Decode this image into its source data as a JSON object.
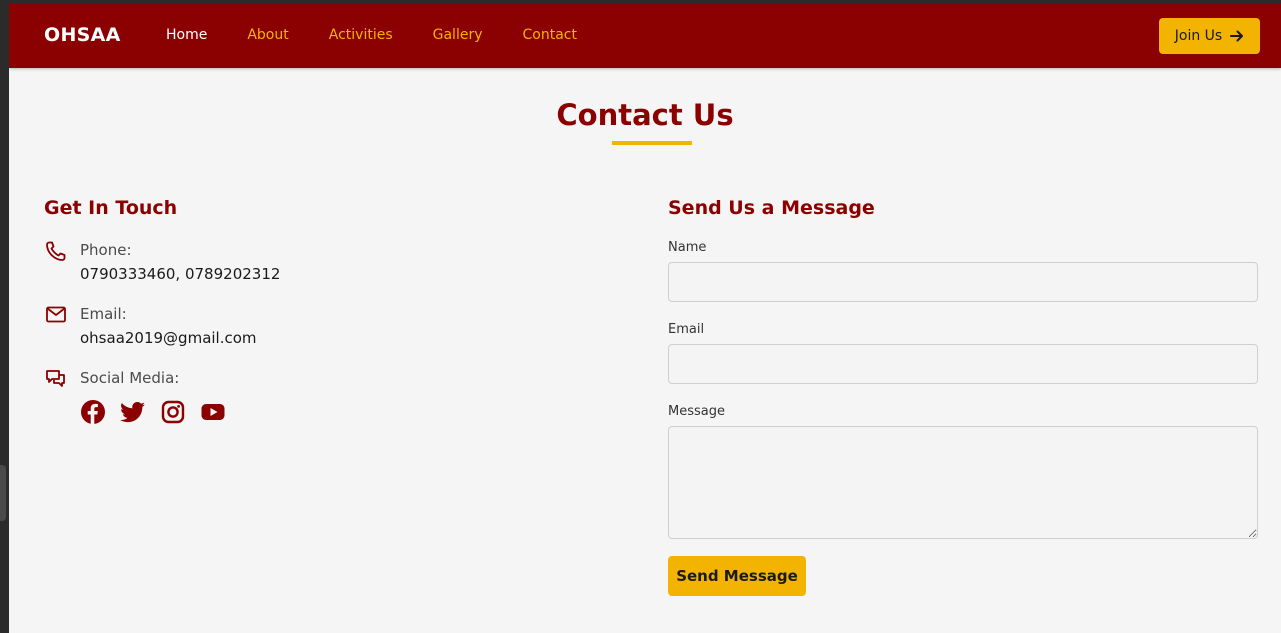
{
  "brand": "OHSAA",
  "nav": {
    "items": [
      "Home",
      "About",
      "Activities",
      "Gallery",
      "Contact"
    ],
    "active": "Home",
    "join_label": "Join Us"
  },
  "colors": {
    "primary": "#8b0000",
    "accent": "#f2b400",
    "background": "#f5f5f5"
  },
  "page": {
    "title": "Contact Us"
  },
  "contact": {
    "heading": "Get In Touch",
    "phone_label": "Phone:",
    "phone_value": "0790333460, 0789202312",
    "email_label": "Email:",
    "email_value": "ohsaa2019@gmail.com",
    "social_label": "Social Media:",
    "social_icons": [
      "facebook-icon",
      "twitter-icon",
      "instagram-icon",
      "youtube-icon"
    ]
  },
  "form": {
    "heading": "Send Us a Message",
    "name_label": "Name",
    "name_value": "",
    "email_label": "Email",
    "email_value": "",
    "message_label": "Message",
    "message_value": "",
    "submit_label": "Send Message"
  }
}
